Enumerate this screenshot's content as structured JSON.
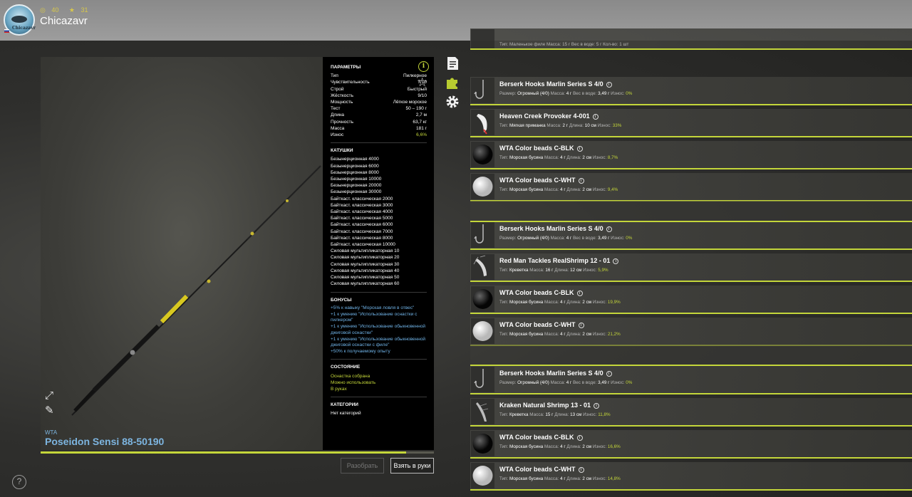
{
  "header": {
    "level_a": "40",
    "level_b": "31",
    "username": "Chicazavr",
    "avatar_text": "Chicazavr"
  },
  "rod": {
    "brand": "WTA",
    "name": "Poseidon Sensi 88-50190",
    "progress": 0.93
  },
  "params": {
    "title": "ПАРАМЕТРЫ",
    "rows": [
      {
        "k": "Тип",
        "v": "Пилкерное"
      },
      {
        "k": "Чувствительность",
        "v": "7/10"
      },
      {
        "k": "Строй",
        "v": "Быстрый"
      },
      {
        "k": "Жёсткость",
        "v": "9/10"
      },
      {
        "k": "Мощность",
        "v": "Лёгкое морское"
      },
      {
        "k": "Тест",
        "v": "50 – 190 г"
      },
      {
        "k": "Длина",
        "v": "2,7 м"
      },
      {
        "k": "Прочность",
        "v": "63,7 кг"
      },
      {
        "k": "Масса",
        "v": "181 г"
      },
      {
        "k": "Износ",
        "v": "6,6%"
      }
    ],
    "reels_title": "КАТУШКИ",
    "reels": [
      "Безынерционная 4000",
      "Безынерционная 6000",
      "Безынерционная 8000",
      "Безынерционная 10000",
      "Безынерционная 20000",
      "Безынерционная 30000",
      "Байткаст. классическая 2000",
      "Байткаст. классическая 3000",
      "Байткаст. классическая 4000",
      "Байткаст. классическая 5000",
      "Байткаст. классическая 6000",
      "Байткаст. классическая 7000",
      "Байткаст. классическая 8000",
      "Байткаст. классическая 10000",
      "Силовая мультипликаторная 10",
      "Силовая мультипликаторная 20",
      "Силовая мультипликаторная 30",
      "Силовая мультипликаторная 40",
      "Силовая мультипликаторная 50",
      "Силовая мультипликаторная 60"
    ],
    "bonuses_title": "БОНУСЫ",
    "bonuses": [
      "+5% к навыку \"Морская ловля в отвес\"",
      "+1 к умению \"Использование оснастки с пилкером\"",
      "+1 к умению \"Использование обыкновенной джиговой оснастки\"",
      "+1 к умению \"Использование обыкновенной джиговой оснастки с филе\"",
      "+50% к получаемому опыту"
    ],
    "state_title": "СОСТОЯНИЕ",
    "states": [
      "Оснастка собрана",
      "Можно использовать",
      "В руках"
    ],
    "categories_title": "КАТЕГОРИИ",
    "categories": "Нет категорий"
  },
  "buttons": {
    "disassemble": "Разобрать",
    "take": "Взять в руки"
  },
  "icons": {
    "info": "i",
    "star": "☆",
    "expand": "⤢",
    "pipette": "✎",
    "help": "?"
  },
  "top_item": {
    "sub": "Тип: Маленькое филе  Масса: 15 г  Вес в воде: 5 г  Кол-во: 1 шт"
  },
  "items": [
    {
      "title": "Berserk Hooks Marlin Series S 4/0",
      "sub_a": "Размер: ",
      "sub_b": "Огромный (4/0)",
      "sub_c": "  Масса: ",
      "sub_d": "4 г",
      "sub_e": "  Вес в воде: ",
      "sub_f": "3,49 г",
      "sub_g": "  Износ: ",
      "wear": "0%",
      "thumb": "hook"
    },
    {
      "title": "Heaven Creek Provoker 4-001",
      "sub_a": "Тип: ",
      "sub_b": "Мягкая приманка",
      "sub_c": "  Масса: ",
      "sub_d": "2 г",
      "sub_e": "  Длина: ",
      "sub_f": "10 см",
      "sub_g": "  Износ: ",
      "wear": "33%",
      "thumb": "lure"
    },
    {
      "title": "WTA Color beads C-BLK",
      "sub_a": "Тип: ",
      "sub_b": "Морская бусина",
      "sub_c": "  Масса: ",
      "sub_d": "4 г",
      "sub_e": "  Длина: ",
      "sub_f": "2 см",
      "sub_g": "  Износ: ",
      "wear": "8,7%",
      "thumb": "black"
    },
    {
      "title": "WTA Color beads C-WHT",
      "sub_a": "Тип: ",
      "sub_b": "Морская бусина",
      "sub_c": "  Масса: ",
      "sub_d": "4 г",
      "sub_e": "  Длина: ",
      "sub_f": "2 см",
      "sub_g": "  Износ: ",
      "wear": "9,4%",
      "thumb": "white"
    },
    {
      "title": "Berserk Hooks Marlin Series S 4/0",
      "sub_a": "Размер: ",
      "sub_b": "Огромный (4/0)",
      "sub_c": "  Масса: ",
      "sub_d": "4 г",
      "sub_e": "  Вес в воде: ",
      "sub_f": "3,49 г",
      "sub_g": "  Износ: ",
      "wear": "0%",
      "thumb": "hook"
    },
    {
      "title": "Red Man Tackles RealShrimp 12 - 01",
      "sub_a": "Тип: ",
      "sub_b": "Креветка",
      "sub_c": "  Масса: ",
      "sub_d": "16 г",
      "sub_e": "  Длина: ",
      "sub_f": "12 см",
      "sub_g": "  Износ: ",
      "wear": "5,9%",
      "thumb": "shrimp"
    },
    {
      "title": "WTA Color beads C-BLK",
      "sub_a": "Тип: ",
      "sub_b": "Морская бусина",
      "sub_c": "  Масса: ",
      "sub_d": "4 г",
      "sub_e": "  Длина: ",
      "sub_f": "2 см",
      "sub_g": "  Износ: ",
      "wear": "19,9%",
      "thumb": "black"
    },
    {
      "title": "WTA Color beads C-WHT",
      "sub_a": "Тип: ",
      "sub_b": "Морская бусина",
      "sub_c": "  Масса: ",
      "sub_d": "4 г",
      "sub_e": "  Длина: ",
      "sub_f": "2 см",
      "sub_g": "  Износ: ",
      "wear": "21,2%",
      "thumb": "white"
    },
    {
      "title": "Berserk Hooks Marlin Series S 4/0",
      "sub_a": "Размер: ",
      "sub_b": "Огромный (4/0)",
      "sub_c": "  Масса: ",
      "sub_d": "4 г",
      "sub_e": "  Вес в воде: ",
      "sub_f": "3,49 г",
      "sub_g": "  Износ: ",
      "wear": "0%",
      "thumb": "hook"
    },
    {
      "title": "Kraken Natural Shrimp 13 - 01",
      "sub_a": "Тип: ",
      "sub_b": "Креветка",
      "sub_c": "  Масса: ",
      "sub_d": "15 г",
      "sub_e": "  Длина: ",
      "sub_f": "13 см",
      "sub_g": "  Износ: ",
      "wear": "11,8%",
      "thumb": "shrimp2"
    },
    {
      "title": "WTA Color beads C-BLK",
      "sub_a": "Тип: ",
      "sub_b": "Морская бусина",
      "sub_c": "  Масса: ",
      "sub_d": "4 г",
      "sub_e": "  Длина: ",
      "sub_f": "2 см",
      "sub_g": "  Износ: ",
      "wear": "16,6%",
      "thumb": "black"
    },
    {
      "title": "WTA Color beads C-WHT",
      "sub_a": "Тип: ",
      "sub_b": "Морская бусина",
      "sub_c": "  Масса: ",
      "sub_d": "4 г",
      "sub_e": "  Длина: ",
      "sub_f": "2 см",
      "sub_g": "  Износ: ",
      "wear": "14,8%",
      "thumb": "white"
    }
  ],
  "colors": {
    "accent": "#c4d63a",
    "link": "#6fb2e6"
  }
}
